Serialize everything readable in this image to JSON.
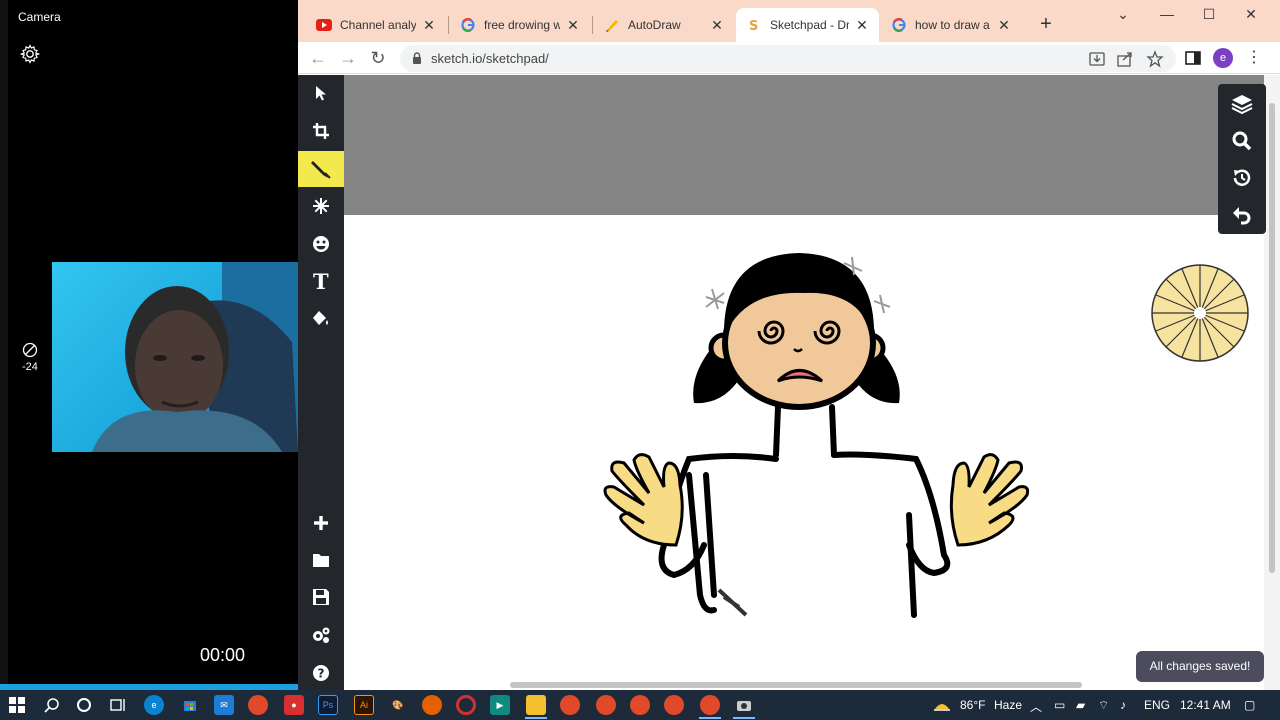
{
  "camera": {
    "title": "Camera",
    "exposure": "-24",
    "timer": "00:00"
  },
  "browser": {
    "tabs": [
      {
        "label": "Channel analytic",
        "icon": "youtube-icon",
        "active": false
      },
      {
        "label": "free drowing wel",
        "icon": "google-icon",
        "active": false
      },
      {
        "label": "AutoDraw",
        "icon": "autodraw-icon",
        "active": false
      },
      {
        "label": "Sketchpad - Dra",
        "icon": "sketchpad-icon",
        "active": true
      },
      {
        "label": "how to draw a c",
        "icon": "google-icon",
        "active": false
      }
    ],
    "url": "sketch.io/sketchpad/",
    "profile_initial": "e"
  },
  "sketchpad": {
    "tools": [
      "select",
      "crop",
      "pen",
      "stamp",
      "emoji",
      "text",
      "fill"
    ],
    "bottom_tools": [
      "add",
      "open",
      "save",
      "settings",
      "help"
    ],
    "active_tool": "pen",
    "saved_message": "All changes saved!"
  },
  "taskbar": {
    "temperature": "86°F",
    "weather": "Haze",
    "language": "ENG",
    "time": "12:41 AM"
  },
  "colors": {
    "tab_strip": "#fad9c9",
    "active_tool": "#f2ea4c",
    "sidebar": "#23272b",
    "skin": "#f0c89a",
    "hand": "#f7db85"
  }
}
